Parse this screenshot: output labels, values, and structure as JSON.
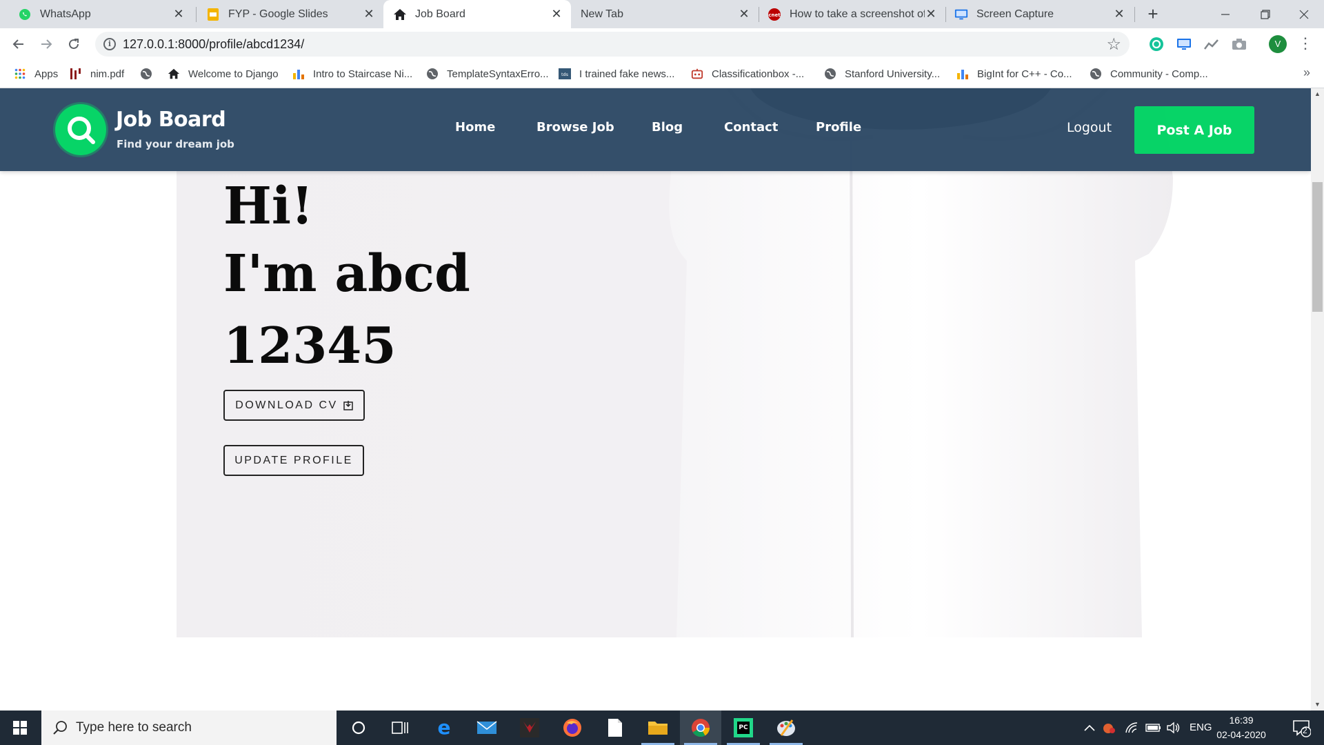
{
  "browser": {
    "tabs": [
      {
        "title": "WhatsApp",
        "icon": "whatsapp-icon",
        "active": false
      },
      {
        "title": "FYP - Google Slides",
        "icon": "google-slides-icon",
        "active": false
      },
      {
        "title": "Job Board",
        "icon": "home-icon",
        "active": true
      },
      {
        "title": "New Tab",
        "icon": "",
        "active": false
      },
      {
        "title": "How to take a screenshot of",
        "icon": "cnet-icon",
        "active": false
      },
      {
        "title": "Screen Capture",
        "icon": "screen-capture-icon",
        "active": false
      }
    ],
    "url": "127.0.0.1:8000/profile/abcd1234/",
    "profile_initial": "V",
    "bookmarks": [
      {
        "label": "Apps",
        "icon": "apps-grid-icon"
      },
      {
        "label": "nim.pdf",
        "icon": "pdf-bars-icon"
      },
      {
        "label": "",
        "icon": "globe-icon"
      },
      {
        "label": "Welcome to Django",
        "icon": "home-icon"
      },
      {
        "label": "Intro to Staircase Ni...",
        "icon": "bar-chart-icon"
      },
      {
        "label": "TemplateSyntaxErro...",
        "icon": "globe-icon"
      },
      {
        "label": "I trained fake news...",
        "icon": "tds-icon"
      },
      {
        "label": "Classificationbox -...",
        "icon": "robot-icon"
      },
      {
        "label": "Stanford University...",
        "icon": "globe-icon"
      },
      {
        "label": "BigInt for C++ - Co...",
        "icon": "bar-chart-icon"
      },
      {
        "label": "Community - Comp...",
        "icon": "globe-icon"
      }
    ],
    "bookmarks_more": "»"
  },
  "site": {
    "brand": "Job Board",
    "tagline": "Find your dream job",
    "nav": [
      "Home",
      "Browse Job",
      "Blog",
      "Contact",
      "Profile"
    ],
    "logout": "Logout",
    "post_job": "Post A Job",
    "greeting_line1": "Hi!",
    "greeting_line2": "I'm abcd",
    "greeting_line3": "12345",
    "download_cv": "DOWNLOAD CV",
    "update_profile": "UPDATE PROFILE"
  },
  "taskbar": {
    "search_placeholder": "Type here to search",
    "language": "ENG",
    "time": "16:39",
    "date": "02-04-2020",
    "notification_count": "2"
  },
  "colors": {
    "header_bg": "#2e4a66",
    "accent_green": "#00d363",
    "taskbar_bg": "#1f2a36"
  }
}
